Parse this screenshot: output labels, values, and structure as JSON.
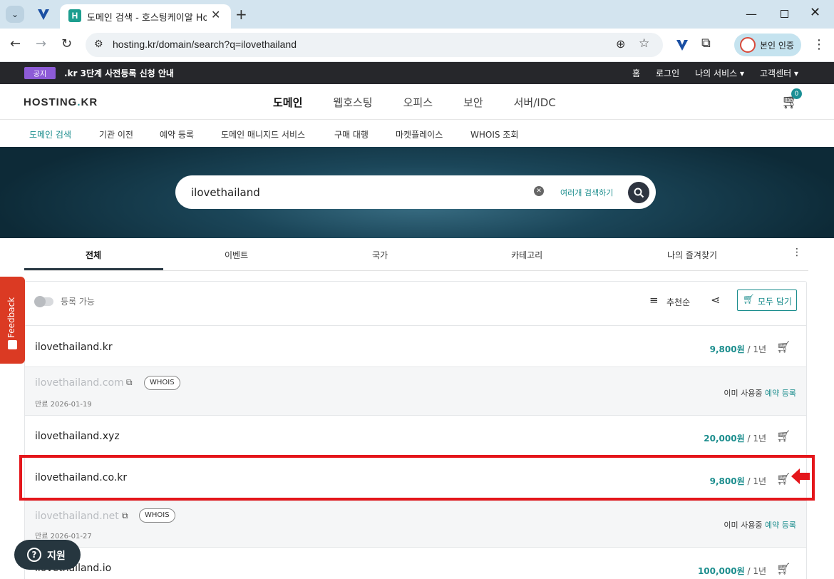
{
  "browser": {
    "tab_title": "도메인 검색 - 호스팅케이알 Ho",
    "tab_favicon_letter": "H",
    "url": "hosting.kr/domain/search?q=ilovethailand",
    "profile_label": "본인 인증"
  },
  "notice": {
    "badge": "공지",
    "text": ".kr 3단계 사전등록 신청 안내"
  },
  "top_links": [
    "홈",
    "로그인",
    "나의 서비스 ▾",
    "고객센터 ▾"
  ],
  "header": {
    "logo_a": "HOSTING",
    "logo_dot": ".",
    "logo_b": "KR",
    "menu": [
      "도메인",
      "웹호스팅",
      "오피스",
      "보안",
      "서버/IDC"
    ],
    "cart_count": "0"
  },
  "subnav": [
    "도메인 검색",
    "기관 이전",
    "예약 등록",
    "도메인 매니지드 서비스",
    "구매 대행",
    "마켓플레이스",
    "WHOIS 조회"
  ],
  "search": {
    "value": "ilovethailand",
    "multi_label": "여러개 검색하기"
  },
  "tabs": [
    "전체",
    "이벤트",
    "국가",
    "카테고리",
    "나의 즐겨찾기"
  ],
  "filters": {
    "toggle_label": "등록 가능",
    "sort_label": "추천순",
    "cart_all_label": "모두 담기"
  },
  "results": [
    {
      "domain": "ilovethailand.kr",
      "price": "9,800원",
      "term": " / 1년"
    },
    {
      "domain": "ilovethailand.com",
      "whois": "WHOIS",
      "expire": "만료 2026-01-19",
      "status": "이미 사용중",
      "action": "예약 등록"
    },
    {
      "domain": "ilovethailand.xyz",
      "price": "20,000원",
      "term": " / 1년"
    },
    {
      "domain": "ilovethailand.co.kr",
      "price": "9,800원",
      "term": " / 1년"
    },
    {
      "domain": "ilovethailand.net",
      "whois": "WHOIS",
      "expire": "만료 2026-01-27",
      "status": "이미 사용중",
      "action": "예약 등록"
    },
    {
      "domain": "ilovethailand.io",
      "price": "100,000원",
      "term": " / 1년"
    }
  ],
  "feedback_label": "Feedback",
  "support_label": "지원",
  "colors": {
    "accent": "#1b8d8d",
    "notice_badge": "#8d5bd7",
    "highlight": "#e4161b",
    "feedback": "#db3a23"
  }
}
